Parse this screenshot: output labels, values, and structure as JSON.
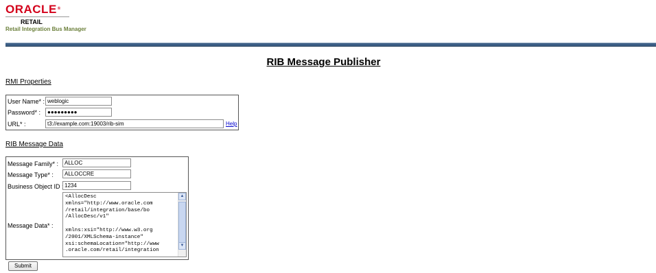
{
  "header": {
    "logo_text": "ORACLE",
    "retail": "RETAIL",
    "app_name": "Retail Integration Bus Manager"
  },
  "page_title": "RIB Message Publisher",
  "rmi": {
    "section_title": "RMI Properties",
    "user_label": "User Name* :",
    "user_value": "weblogic",
    "password_label": "Password* :",
    "password_mask": "●●●●●●●●●",
    "url_label": "URL* :",
    "url_value": "t3://example.com:19003/rib-sim",
    "help": "Help"
  },
  "message": {
    "section_title": "RIB Message Data",
    "family_label": "Message Family* :",
    "family_value": "ALLOC",
    "type_label": "Message Type* :",
    "type_value": "ALLOCCRE",
    "bo_label": "Business Object ID :",
    "bo_value": "1234",
    "data_label": "Message Data* :",
    "data_value": "<AllocDesc\nxmlns=\"http://www.oracle.com\n/retail/integration/base/bo\n/AllocDesc/v1\"\n\nxmlns:xsi=\"http://www.w3.org\n/2001/XMLSchema-instance\"\nxsi:schemaLocation=\"http://www\n.oracle.com/retail/integration"
  },
  "submit": "Submit"
}
